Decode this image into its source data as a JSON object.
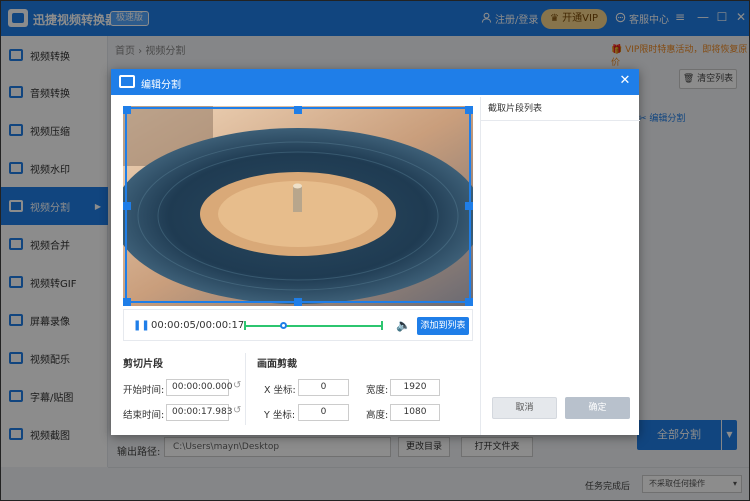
{
  "app": {
    "title": "迅捷视频转换器",
    "badge": "极速版",
    "login": "注册/登录",
    "vip": "开通VIP",
    "service": "客服中心",
    "minimize": "—",
    "maximize": "☐",
    "close": "✕"
  },
  "sidebar": {
    "items": [
      {
        "label": "视频转换"
      },
      {
        "label": "音频转换"
      },
      {
        "label": "视频压缩"
      },
      {
        "label": "视频水印"
      },
      {
        "label": "视频分割",
        "active": true
      },
      {
        "label": "视频合并"
      },
      {
        "label": "视频转GIF"
      },
      {
        "label": "屏幕录像"
      },
      {
        "label": "视频配乐"
      },
      {
        "label": "字幕/贴图"
      },
      {
        "label": "视频截图"
      }
    ]
  },
  "main": {
    "breadcrumb": "首页 › 视频分割",
    "promo": "VIP限时特惠活动，即将恢复原价",
    "clear_list": "清空列表",
    "edit_split": "编辑分割",
    "split_all": "全部分割",
    "output_label": "输出路径:",
    "output_path": "C:\\Users\\mayn\\Desktop",
    "change_dir": "更改目录",
    "open_folder": "打开文件夹",
    "task_done_label": "任务完成后",
    "task_done_option": "不采取任何操作"
  },
  "dialog": {
    "title": "编辑分割",
    "time": "00:00:05/00:00:17",
    "playback_fraction": 0.29,
    "add_to_list": "添加到列表",
    "clips_header": "截取片段列表",
    "cancel": "取消",
    "confirm": "确定",
    "cut_section": "剪切片段",
    "start_label": "开始时间:",
    "start_value": "00:00:00.000",
    "end_label": "结束时间:",
    "end_value": "00:00:17.983",
    "crop_section": "画面剪裁",
    "x_label": "X 坐标:",
    "x_value": "0",
    "y_label": "Y 坐标:",
    "y_value": "0",
    "width_label": "宽度:",
    "width_value": "1920",
    "height_label": "高度:",
    "height_value": "1080"
  },
  "colors": {
    "accent": "#1f7ee8",
    "track": "#2cc56f",
    "vip": "#f6d48a",
    "promo": "#f08a24"
  }
}
